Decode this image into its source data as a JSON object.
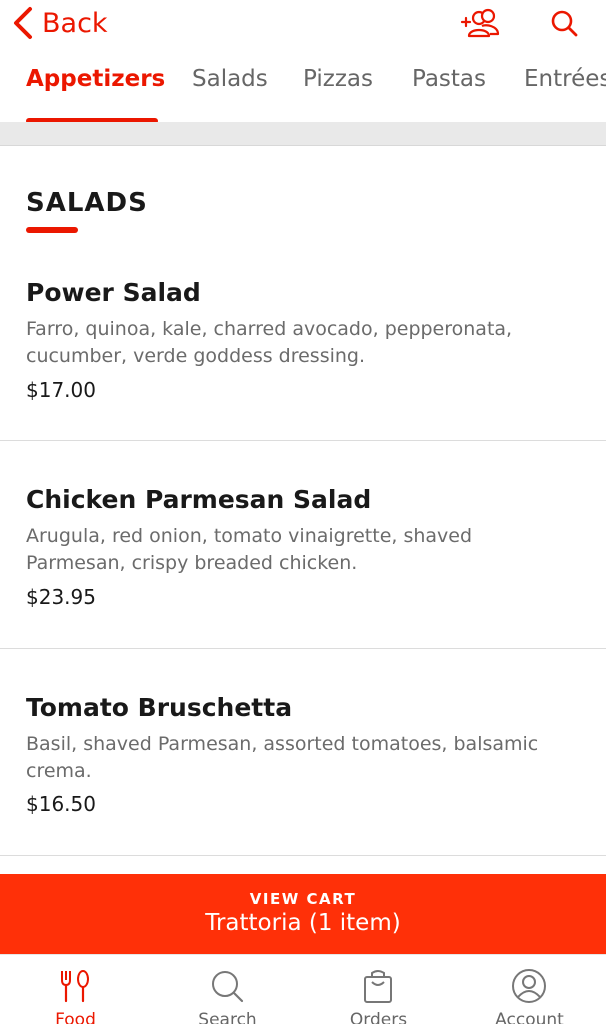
{
  "header": {
    "back_label": "Back",
    "icons": [
      "chevron-left-icon",
      "add-group-icon",
      "search-icon"
    ]
  },
  "tabs": [
    {
      "label": "Appetizers",
      "active": true
    },
    {
      "label": "Salads",
      "active": false
    },
    {
      "label": "Pizzas",
      "active": false
    },
    {
      "label": "Pastas",
      "active": false
    },
    {
      "label": "Entrées",
      "active": false
    }
  ],
  "section": {
    "title": "SALADS"
  },
  "items": [
    {
      "name": "Power Salad",
      "description": "Farro, quinoa, kale, charred avocado, pepperonata, cucumber, verde goddess dressing.",
      "price": "$17.00"
    },
    {
      "name": "Chicken Parmesan Salad",
      "description": "Arugula, red onion, tomato vinaigrette, shaved Parmesan, crispy breaded chicken.",
      "price": "$23.95"
    },
    {
      "name": "Tomato Bruschetta",
      "description": "Basil, shaved Parmesan, assorted tomatoes, balsamic crema.",
      "price": "$16.50"
    }
  ],
  "cart": {
    "kicker": "VIEW CART",
    "title": "Trattoria (1 item)"
  },
  "bottom_nav": [
    {
      "label": "Food",
      "icon": "fork-knife-icon",
      "active": true
    },
    {
      "label": "Search",
      "icon": "search-icon",
      "active": false
    },
    {
      "label": "Orders",
      "icon": "shopping-bag-icon",
      "active": false
    },
    {
      "label": "Account",
      "icon": "person-circle-icon",
      "active": false
    }
  ],
  "colors": {
    "accent": "#eb1700",
    "cart_background": "#ff3008",
    "text_primary": "#191919",
    "text_secondary": "#6b6b6b"
  }
}
